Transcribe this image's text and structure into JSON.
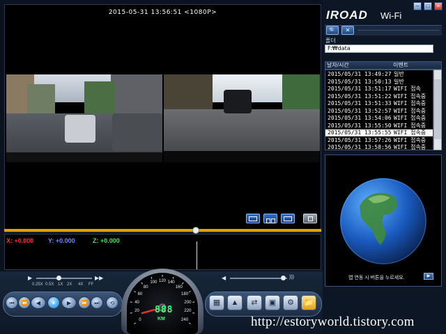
{
  "window": {
    "logo": "IROAD",
    "logo_suffix": "Wi-Fi",
    "minimize_icon": "–",
    "maximize_icon": "□",
    "close_icon": "×"
  },
  "video": {
    "timestamp": "2015-05-31 13:56:51 <1080P>"
  },
  "gsensor": {
    "x_label": "X:",
    "x_value": "+0.000",
    "y_label": "Y:",
    "y_value": "+0.000",
    "z_label": "Z:",
    "z_value": "+0.000",
    "colors": {
      "x": "#ff2a2a",
      "y": "#6a8bff",
      "z": "#3ee05a"
    }
  },
  "playback": {
    "speed_labels": [
      "0.25X",
      "0.5X",
      "1X",
      "2X",
      "4X",
      "FF"
    ],
    "play_icon": "▶",
    "ff_icon": "▶▶",
    "buttons": [
      "⏮",
      "⏪",
      "◀",
      "⏸",
      "▶",
      "⏩",
      "⏭",
      "⟲"
    ],
    "tool_icons": [
      "film-icon",
      "cone-icon",
      "transfer-icon",
      "save-icon",
      "gear-icon",
      "folder-icon"
    ],
    "tool_glyphs": [
      "▦",
      "▲",
      "⇄",
      "▣",
      "⚙",
      "📁"
    ],
    "volume_icon": "◀",
    "volume_wave_icon": ")))"
  },
  "speedometer": {
    "ticks": [
      "0",
      "20",
      "40",
      "60",
      "80",
      "100",
      "120",
      "140",
      "160",
      "180",
      "200",
      "220",
      "240"
    ],
    "readout": "888",
    "unit": "KM"
  },
  "sidebar": {
    "folder_label": "폴더",
    "folder_value": "F:₩data",
    "search_icon": "🔍",
    "settings_icon": "✕",
    "list_headers": {
      "datetime": "날자/시간",
      "event": "이벤트"
    },
    "rows": [
      {
        "datetime": "2015/05/31 13:49:27",
        "event": "일반"
      },
      {
        "datetime": "2015/05/31 13:50:13",
        "event": "일반"
      },
      {
        "datetime": "2015/05/31 13:51:17",
        "event": "WIFI 접속"
      },
      {
        "datetime": "2015/05/31 13:51:22",
        "event": "WIFI 접속중"
      },
      {
        "datetime": "2015/05/31 13:51:33",
        "event": "WIFI 접속중"
      },
      {
        "datetime": "2015/05/31 13:52:57",
        "event": "WIFI 접속중"
      },
      {
        "datetime": "2015/05/31 13:54:06",
        "event": "WIFI 접속중"
      },
      {
        "datetime": "2015/05/31 13:55:50",
        "event": "WIFI 접속중"
      },
      {
        "datetime": "2015/05/31 13:55:55",
        "event": "WIFI 접속중"
      },
      {
        "datetime": "2015/05/31 13:57:26",
        "event": "WIFI 접속중"
      },
      {
        "datetime": "2015/05/31 13:58:56",
        "event": "WIFI 접속중"
      }
    ],
    "selected_row": 8,
    "map_hint": "맵 연동 시 버튼을 누르세요.",
    "map_button_icon": "▶"
  },
  "watermark": "http://estoryworld.tistory.com"
}
